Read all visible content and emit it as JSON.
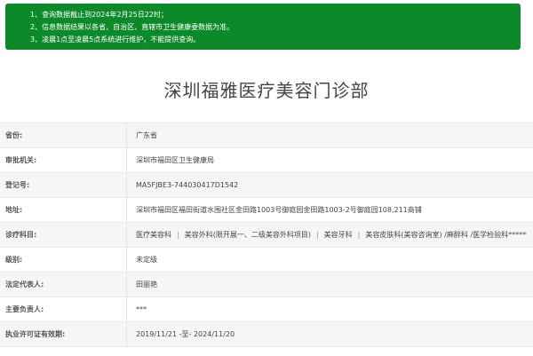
{
  "notice": {
    "lines": [
      "1、查询数据截止到2024年2月25日22时；",
      "2、信息数据结果以各省、自治区、直辖市卫生健康委数据为准。",
      "3、凌晨1点至凌晨5点系统进行维护，不能提供查询。"
    ]
  },
  "title": "深圳福雅医疗美容门诊部",
  "rows": [
    {
      "label": "省份:",
      "value": "广东省"
    },
    {
      "label": "审批机关:",
      "value": "深圳市福田区卫生健康局"
    },
    {
      "label": "登记号:",
      "value": "MA5FJBE3-744030417D1542"
    },
    {
      "label": "地址:",
      "value": "深圳市福田区福田街道水围社区金田路1003号御庭园金田路1003-2号御庭园108,211商铺"
    },
    {
      "label": "诊疗科目:",
      "value_parts": [
        "医疗美容科",
        "美容外科(限开展一、二级美容外科项目)",
        "美容牙科",
        "美容皮肤科(美容咨询室) /麻醉科 /医学检验科******"
      ]
    },
    {
      "label": "级别:",
      "value": "未定级"
    },
    {
      "label": "法定代表人:",
      "value": "田丽艳"
    },
    {
      "label": "主要负责人:",
      "value": "***"
    },
    {
      "label": "执业许可证有效期:",
      "value": "2019/11/21 -至- 2024/11/20"
    }
  ]
}
